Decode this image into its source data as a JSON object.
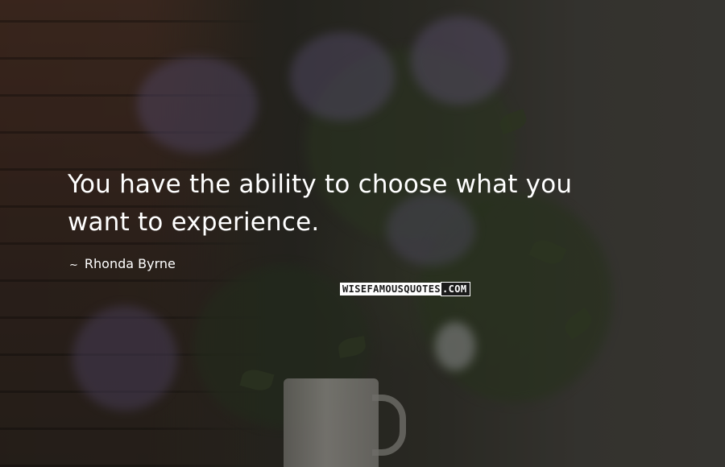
{
  "quote": {
    "text_line1": "You have the ability to choose what you",
    "text_line2": "want to experience.",
    "author_prefix": "~",
    "author": "Rhonda Byrne"
  },
  "watermark": {
    "text_main": "WISEFAMOUSQUOTES",
    "text_suffix": ".COM"
  },
  "background": {
    "description_colors": {
      "wall_left": "#4a3127",
      "wall_right": "#4d4b45",
      "foliage": "#3e4a2e",
      "flowers": "#7a6f9a",
      "vase": "#b7b4ad"
    }
  }
}
